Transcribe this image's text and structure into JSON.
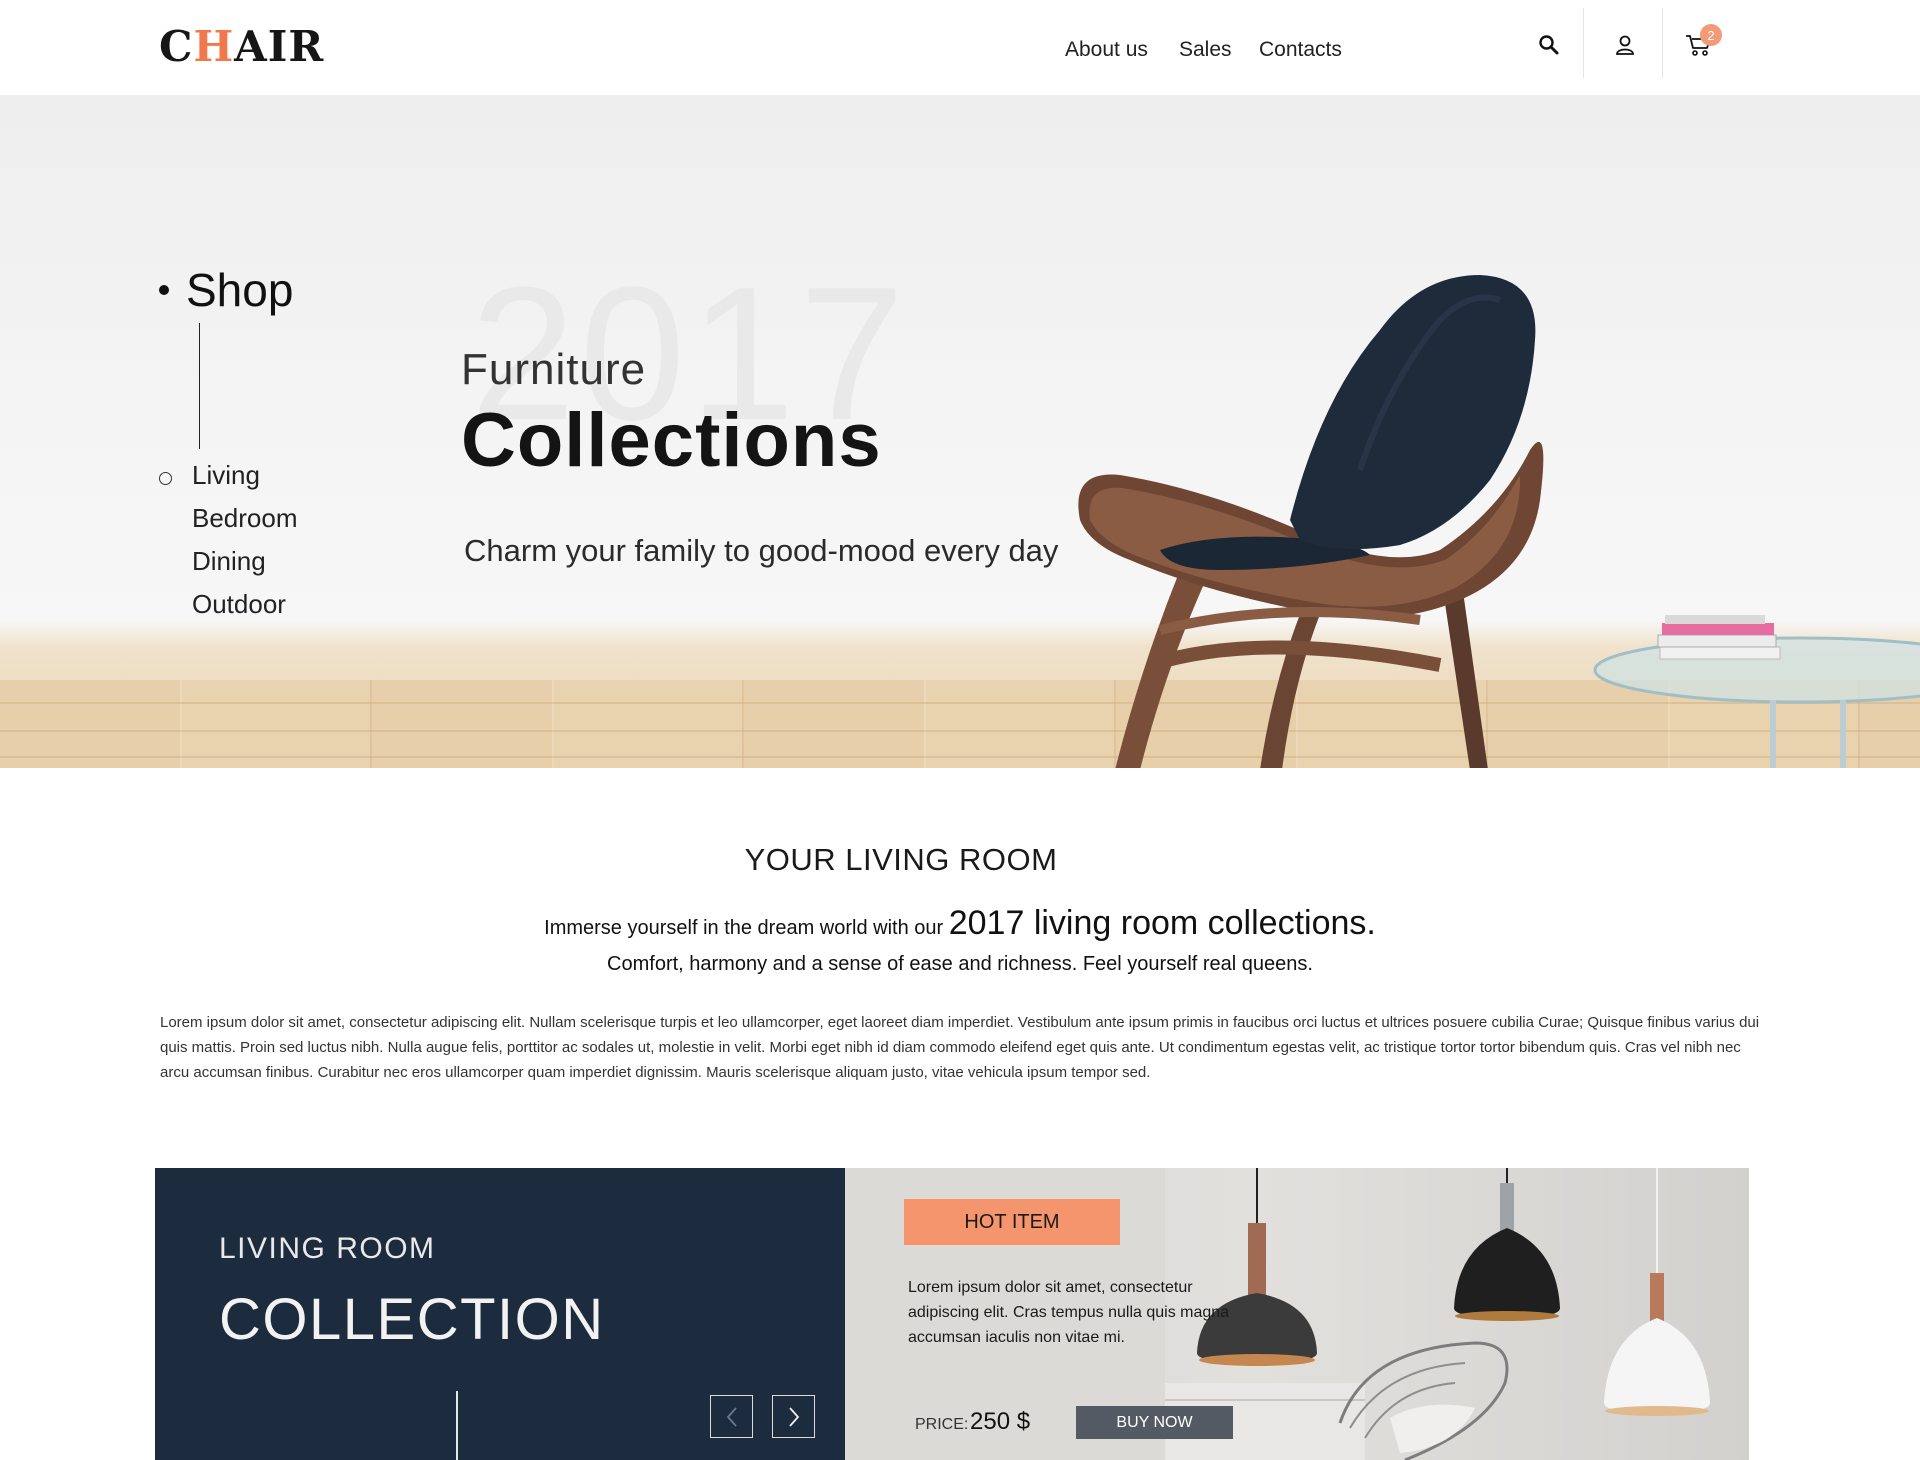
{
  "header": {
    "logo_before": "C",
    "logo_accent": "H",
    "logo_after": "AIR",
    "nav": [
      "About us",
      "Sales",
      "Contacts"
    ],
    "cart_count": "2",
    "icons": [
      "search-icon",
      "user-icon",
      "cart-icon"
    ]
  },
  "hero": {
    "watermark": "2017",
    "shop_title": "Shop",
    "categories": [
      "Living",
      "Bedroom",
      "Dining",
      "Outdoor"
    ],
    "title_small": "Furniture",
    "title_big": "Collections",
    "tagline": "Charm your family to good-mood every day"
  },
  "intro": {
    "title": "YOUR LIVING ROOM",
    "line1_small": "Immerse yourself in the dream world with our ",
    "line1_big": "2017 living room collections.",
    "line2": "Comfort, harmony and a sense of ease and richness. Feel yourself real queens.",
    "lorem": "Lorem ipsum dolor sit amet, consectetur adipiscing elit. Nullam scelerisque turpis et leo ullamcorper, eget laoreet diam imperdiet. Vestibulum ante ipsum primis in faucibus orci luctus et ultrices posuere cubilia Curae; Quisque finibus varius dui quis mattis. Proin sed luctus nibh. Nulla augue felis, porttitor ac sodales ut, molestie in velit. Morbi eget nibh id diam commodo eleifend eget quis ante. Ut condimentum egestas velit, ac tristique tortor tortor bibendum quis. Cras vel nibh nec arcu accumsan finibus. Curabitur nec eros ullamcorper quam imperdiet dignissim. Mauris scelerisque aliquam justo, vitae vehicula ipsum tempor sed."
  },
  "collection": {
    "subtitle": "LIVING ROOM",
    "title": "COLLECTION",
    "badge": "HOT ITEM",
    "description": "Lorem ipsum dolor sit amet, consectetur adipiscing elit. Cras tempus nulla quis magna accumsan iaculis non vitae mi.",
    "price_label": "PRICE:",
    "price": "250 $",
    "buy_label": "BUY NOW"
  },
  "colors": {
    "accent": "#f0784b",
    "badge": "#f5956d",
    "dark_panel": "#1d2b3e",
    "buy_button": "#535a64"
  }
}
